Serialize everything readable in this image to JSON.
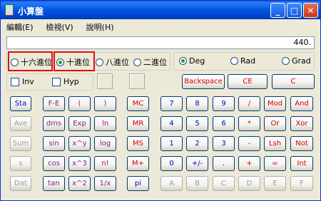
{
  "title": "小算盤",
  "titlebar": {
    "minimize": "_",
    "maximize": "□",
    "close": "✕"
  },
  "menu": [
    "編輯(E)",
    "檢視(V)",
    "說明(H)"
  ],
  "display_value": "440.",
  "base_radios": [
    "十六進位",
    "十進位",
    "八進位",
    "二進位"
  ],
  "base_selected": "十進位",
  "angle_radios": [
    "Deg",
    "Rad",
    "Grad"
  ],
  "angle_selected": "Deg",
  "checks": [
    "Inv",
    "Hyp"
  ],
  "edit_buttons": [
    "Backspace",
    "CE",
    "C"
  ],
  "memory_buttons": [
    "MC",
    "MR",
    "MS",
    "M+"
  ],
  "stat_buttons": [
    "Sta",
    "Ave",
    "Sum",
    "s",
    "Dat"
  ],
  "sci_col1": [
    "F-E",
    "dms",
    "sin",
    "cos",
    "tan"
  ],
  "sci_col2": [
    "(",
    "Exp",
    "x^y",
    "x^3",
    "x^2"
  ],
  "sci_col3": [
    ")",
    "ln",
    "log",
    "n!",
    "1/x"
  ],
  "pi_label": "pi",
  "keypad": [
    [
      "7",
      "8",
      "9",
      "/",
      "Mod",
      "And"
    ],
    [
      "4",
      "5",
      "6",
      "*",
      "Or",
      "Xor"
    ],
    [
      "1",
      "2",
      "3",
      "-",
      "Lsh",
      "Not"
    ],
    [
      "0",
      "+/-",
      ".",
      "+",
      "=",
      "Int"
    ],
    [
      "A",
      "B",
      "C",
      "D",
      "E",
      "F"
    ]
  ],
  "colors": {
    "title_bar": "#0055e5",
    "window_bg": "#ece9d8",
    "highlight_box": "#e01010",
    "radio_selected": "#21a121"
  }
}
